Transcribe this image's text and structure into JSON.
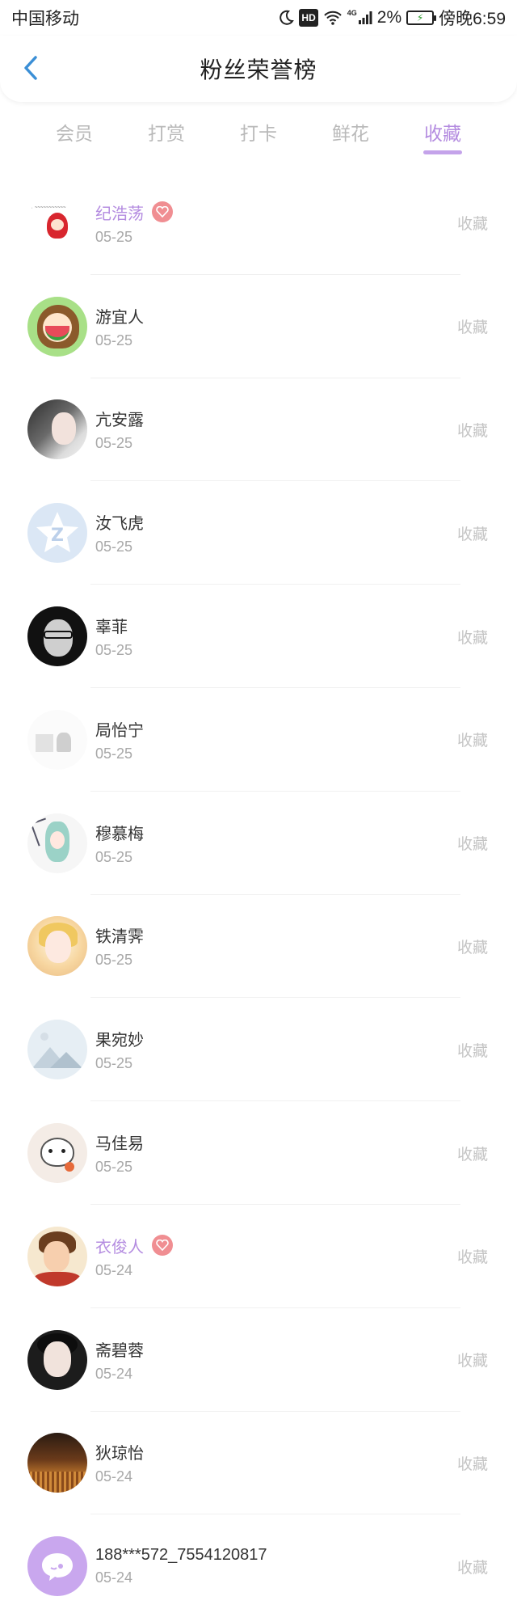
{
  "status_bar": {
    "carrier": "中国移动",
    "network": "4G",
    "battery": "2%",
    "time": "傍晚6:59"
  },
  "header": {
    "title": "粉丝荣誉榜"
  },
  "tabs": [
    {
      "label": "会员",
      "active": false
    },
    {
      "label": "打赏",
      "active": false
    },
    {
      "label": "打卡",
      "active": false
    },
    {
      "label": "鲜花",
      "active": false
    },
    {
      "label": "收藏",
      "active": true
    }
  ],
  "colors": {
    "accent": "#b48ce0",
    "tab_inactive": "#b9b9b9",
    "badge": "#f08e92",
    "action_text": "#c4c4c4"
  },
  "list": {
    "items": [
      {
        "name": "纪浩荡",
        "date": "05-25",
        "action": "收藏",
        "vip": true
      },
      {
        "name": "游宜人",
        "date": "05-25",
        "action": "收藏",
        "vip": false
      },
      {
        "name": "亢安露",
        "date": "05-25",
        "action": "收藏",
        "vip": false
      },
      {
        "name": "汝飞虎",
        "date": "05-25",
        "action": "收藏",
        "vip": false
      },
      {
        "name": "辜菲",
        "date": "05-25",
        "action": "收藏",
        "vip": false
      },
      {
        "name": "局怡宁",
        "date": "05-25",
        "action": "收藏",
        "vip": false
      },
      {
        "name": "穆慕梅",
        "date": "05-25",
        "action": "收藏",
        "vip": false
      },
      {
        "name": "铁清霁",
        "date": "05-25",
        "action": "收藏",
        "vip": false
      },
      {
        "name": "果宛妙",
        "date": "05-25",
        "action": "收藏",
        "vip": false
      },
      {
        "name": "马佳易",
        "date": "05-25",
        "action": "收藏",
        "vip": false
      },
      {
        "name": "衣俊人",
        "date": "05-24",
        "action": "收藏",
        "vip": true
      },
      {
        "name": "斋碧蓉",
        "date": "05-24",
        "action": "收藏",
        "vip": false
      },
      {
        "name": "狄琼怡",
        "date": "05-24",
        "action": "收藏",
        "vip": false
      },
      {
        "name": "188***572_7554120817",
        "date": "05-24",
        "action": "收藏",
        "vip": false
      }
    ]
  }
}
